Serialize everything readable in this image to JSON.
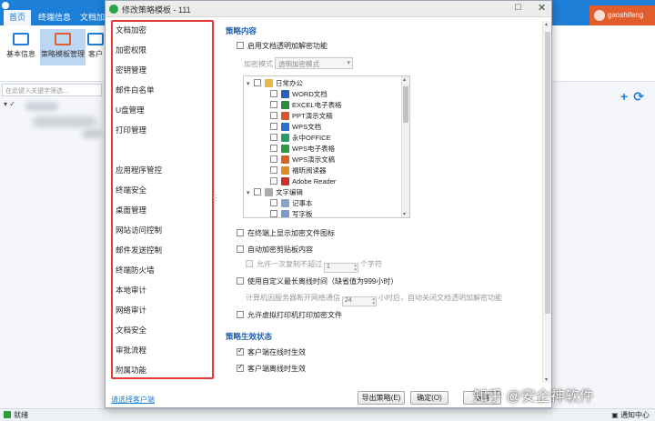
{
  "app": {
    "tabs": [
      "首页",
      "终端信息",
      "文档加"
    ],
    "user": "gaoshifeng",
    "ribbon": [
      "基本信息",
      "策略模板管理",
      "客户"
    ],
    "search_placeholder": "在此键入关键字筛选...",
    "status_left": "就绪",
    "status_right": "通知中心"
  },
  "dialog": {
    "title": "修改策略模板 - 111",
    "nav": [
      "文档加密",
      "加密权限",
      "密钥管理",
      "邮件白名单",
      "U盘管理",
      "打印管理",
      "应用程序管控",
      "终端安全",
      "桌面管理",
      "网站访问控制",
      "邮件发送控制",
      "终端防火墙",
      "本地审计",
      "网络审计",
      "文档安全",
      "审批流程",
      "附属功能"
    ],
    "section1": "策略内容",
    "enable_transparent": "启用文档透明加解密功能",
    "mode_label": "加密模式",
    "mode_value": "透明加密模式",
    "tree": [
      {
        "label": "日常办公",
        "level": 0,
        "exp": "▾",
        "color": "#e8b84a"
      },
      {
        "label": "WORD文档",
        "level": 1,
        "color": "#2b5fb8"
      },
      {
        "label": "EXCEL电子表格",
        "level": 1,
        "color": "#2a8b3e"
      },
      {
        "label": "PPT演示文稿",
        "level": 1,
        "color": "#d5572a"
      },
      {
        "label": "WPS文档",
        "level": 1,
        "color": "#2b6fd0"
      },
      {
        "label": "永中OFFICE",
        "level": 1,
        "color": "#2a9a6a"
      },
      {
        "label": "WPS电子表格",
        "level": 1,
        "color": "#2a9a3e"
      },
      {
        "label": "WPS演示文稿",
        "level": 1,
        "color": "#d8632a"
      },
      {
        "label": "福昕阅读器",
        "level": 1,
        "color": "#e08a2a"
      },
      {
        "label": "Adobe Reader",
        "level": 1,
        "color": "#c8322a"
      },
      {
        "label": "文字编辑",
        "level": 0,
        "exp": "▾",
        "color": "#aaaaaa"
      },
      {
        "label": "记事本",
        "level": 1,
        "color": "#8aa4c8"
      },
      {
        "label": "写字板",
        "level": 1,
        "color": "#7a9ac8"
      }
    ],
    "opt_show_icon": "在终端上显示加密文件图标",
    "opt_clipboard": "自动加密剪贴板内容",
    "opt_allow_copy_a": "允许一次复制不超过",
    "opt_allow_copy_val": "1",
    "opt_allow_copy_b": "个字符",
    "opt_offline": "使用自定义最长离线时间（缺省值为999小时）",
    "opt_offline_a": "计算机因服务器断开网络通信",
    "opt_offline_val": "24",
    "opt_offline_b": "小时后，自动关闭文档透明加解密功能",
    "opt_virtual_print": "允许虚拟打印机打印加密文件",
    "section2": "策略生效状态",
    "eff_online": "客户端在线时生效",
    "eff_offline": "客户端离线时生效",
    "foot_link": "请选择客户端",
    "btn_export": "导出策略(E)",
    "btn_ok": "确定(O)",
    "btn_cancel": "取消"
  },
  "watermark": "知乎 @安企神软件"
}
